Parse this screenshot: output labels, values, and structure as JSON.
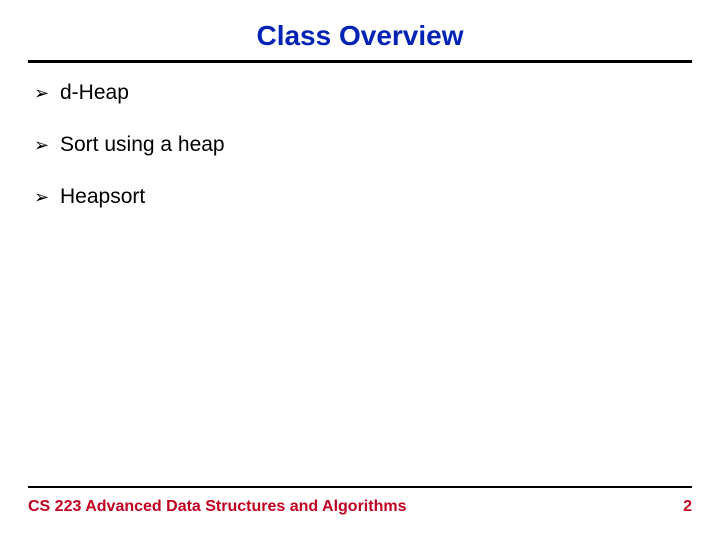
{
  "title": "Class Overview",
  "bullets": {
    "marker": "➢",
    "items": [
      "d-Heap",
      "Sort using a heap",
      "Heapsort"
    ]
  },
  "footer": {
    "course": "CS 223 Advanced Data Structures and Algorithms",
    "page": "2"
  }
}
